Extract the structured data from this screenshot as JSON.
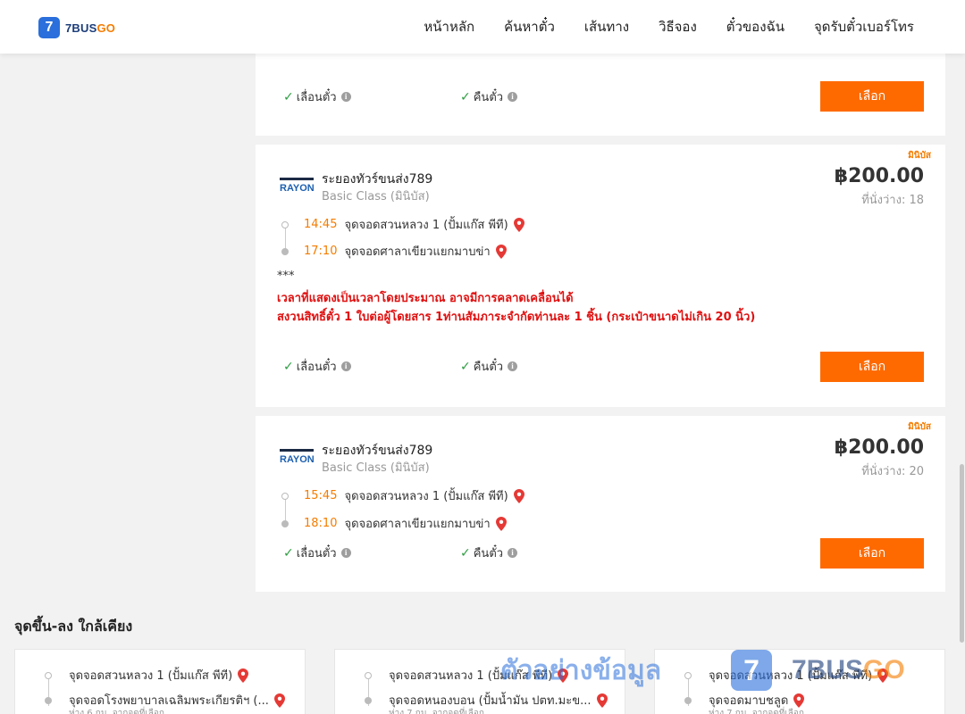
{
  "header": {
    "logo_number": "7",
    "logo_text_a": "7BUS",
    "logo_text_b": "GO",
    "nav": [
      "หน้าหลัก",
      "ค้นหาตั๋ว",
      "เส้นทาง",
      "วิธีจอง",
      "ตั๋วของฉัน",
      "จุดรับตั๋วเบอร์โทร"
    ]
  },
  "common": {
    "feature_reschedule": "เลื่อนตั๋ว",
    "feature_refund": "คืนตั๋ว",
    "select_button": "เลือก",
    "info_icon": "i"
  },
  "trips": [
    {
      "tag": "มินิบัส",
      "operator": "ระยองทัวร์ขนส่ง789",
      "class": "Basic Class (มินิบัส)",
      "price": "฿200.00",
      "seats": "ที่นั่งว่าง: 18",
      "depart_time": "14:45",
      "depart_stop": "จุดจอดสวนหลวง 1 (ปั้มแก๊ส พีที)",
      "arrive_time": "17:10",
      "arrive_stop": "จุดจอดศาลาเขียวแยกมาบข่า",
      "note_stars": "***",
      "note_line1": "เวลาที่แสดงเป็นเวลาโดยประมาณ อาจมีการคลาดเคลื่อนได้",
      "note_line2": "สงวนสิทธิ์ตั๋ว 1 ใบต่อผู้โดยสาร 1ท่านสัมภาระจำกัดท่านละ 1 ชิ้น (กระเป๋าขนาดไม่เกิน 20 นิ้ว)"
    },
    {
      "tag": "มินิบัส",
      "operator": "ระยองทัวร์ขนส่ง789",
      "class": "Basic Class (มินิบัส)",
      "price": "฿200.00",
      "seats": "ที่นั่งว่าง: 20",
      "depart_time": "15:45",
      "depart_stop": "จุดจอดสวนหลวง 1 (ปั้มแก๊ส พีที)",
      "arrive_time": "18:10",
      "arrive_stop": "จุดจอดศาลาเขียวแยกมาบข่า"
    }
  ],
  "nearby": {
    "title": "จุดขึ้น-ลง ใกล้เคียง",
    "cards": [
      {
        "from": "จุดจอดสวนหลวง 1 (ปั้มแก๊ส พีที)",
        "to": "จุดจอดโรงพยาบาลเฉลิมพระเกียรติฯ (...",
        "sub": "ห่าง 6 กม. จากจุดที่เลือก"
      },
      {
        "from": "จุดจอดสวนหลวง 1 (ปั้มแก๊ส พีที)",
        "to": "จุดจอดหนองบอน (ปั้มน้ำมัน ปตท.มะข...",
        "sub": "ห่าง 7 กม. จากจุดที่เลือก"
      },
      {
        "from": "จุดจอดสวนหลวง 1 (ปั้มแก๊ส พีที)",
        "to": "จุดจอดมาบชลูด",
        "sub": "ห่าง 7 กม. จากจุดที่เลือก"
      }
    ]
  },
  "watermark": {
    "text": "ตัวอย่างข้อมูล",
    "badge": "7",
    "word_a": "7BUS",
    "word_b": "GO"
  },
  "colors": {
    "accent": "#ff6a00",
    "time": "#f57c00",
    "brand_blue": "#2a6fdb",
    "notice_red": "#e01010",
    "check_green": "#2e9e43"
  }
}
